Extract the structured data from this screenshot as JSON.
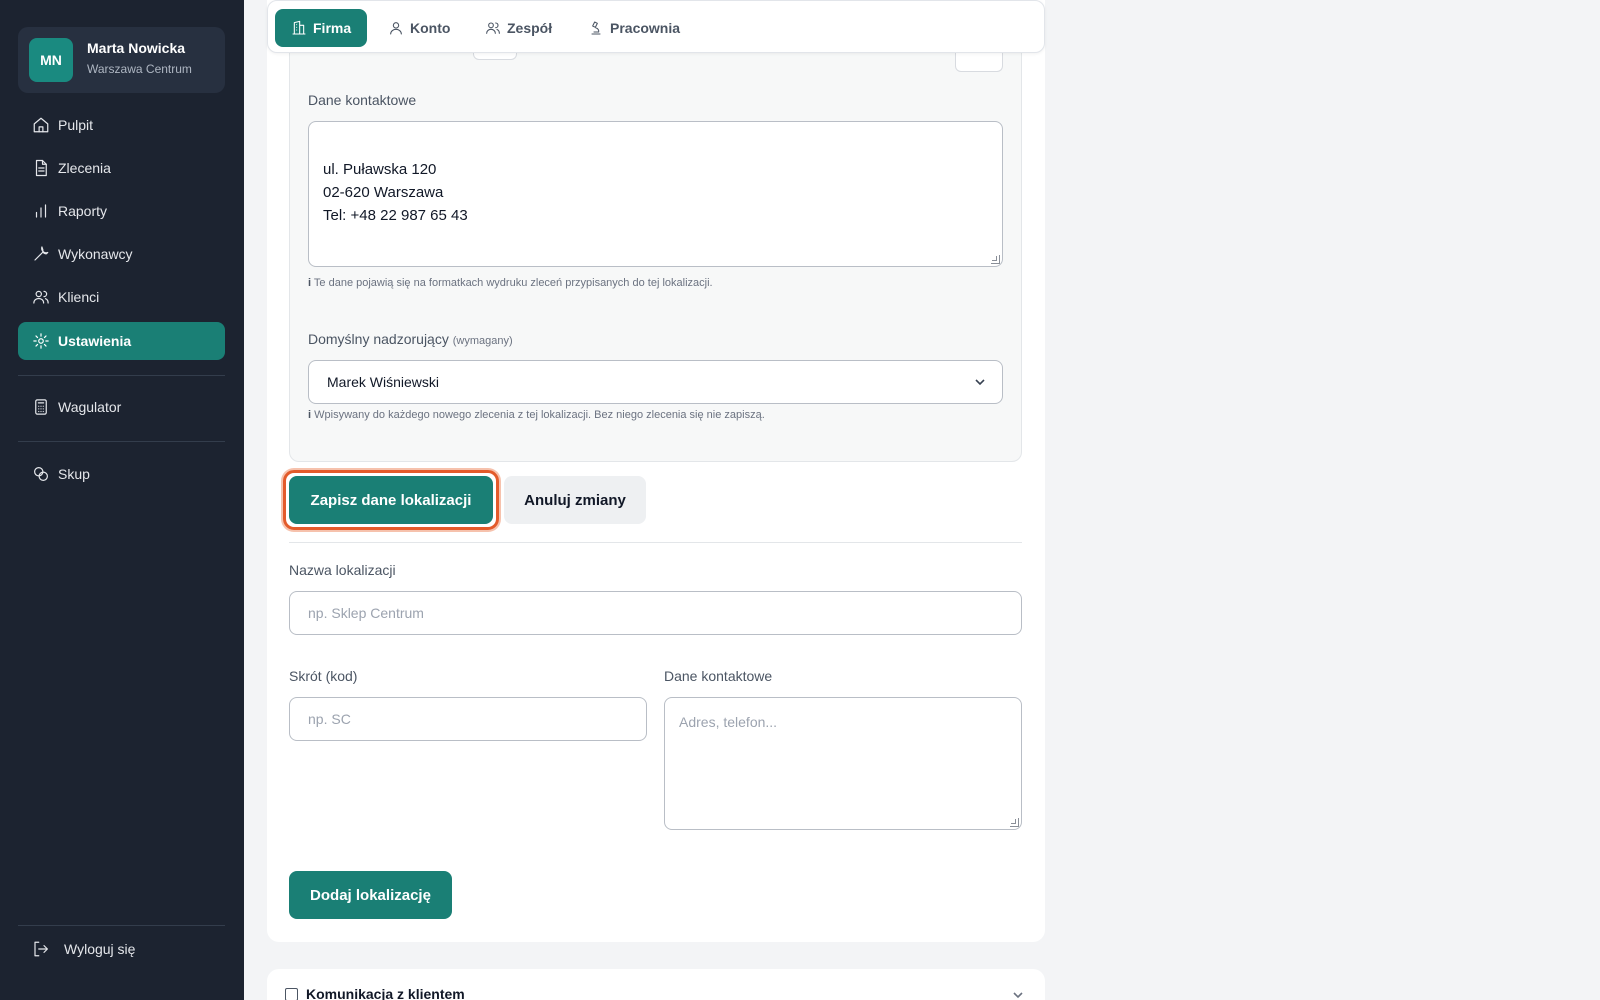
{
  "user": {
    "initials": "MN",
    "name": "Marta Nowicka",
    "location": "Warszawa Centrum"
  },
  "sidebar": {
    "items": [
      {
        "label": "Pulpit",
        "icon": "home-icon"
      },
      {
        "label": "Zlecenia",
        "icon": "document-icon"
      },
      {
        "label": "Raporty",
        "icon": "bar-chart-icon"
      },
      {
        "label": "Wykonawcy",
        "icon": "wrench-icon"
      },
      {
        "label": "Klienci",
        "icon": "users-icon"
      },
      {
        "label": "Ustawienia",
        "icon": "gear-icon",
        "active": true
      },
      {
        "label": "Wagulator",
        "icon": "calculator-icon"
      },
      {
        "label": "Skup",
        "icon": "coins-icon"
      }
    ],
    "logout": "Wyloguj się"
  },
  "tabs": [
    {
      "label": "Firma",
      "icon": "building-icon",
      "active": true
    },
    {
      "label": "Konto",
      "icon": "user-icon"
    },
    {
      "label": "Zespół",
      "icon": "team-icon"
    },
    {
      "label": "Pracownia",
      "icon": "microscope-icon"
    }
  ],
  "edit_location": {
    "contact_label": "Dane kontaktowe",
    "contact_value": "ul. Puławska 120\n02-620 Warszawa\nTel: +48 22 987 65 43",
    "contact_hint_icon": "i",
    "contact_hint": "Te dane pojawią się na formatkach wydruku zleceń przypisanych do tej lokalizacji.",
    "supervisor_label": "Domyślny nadzorujący",
    "supervisor_required": "(wymagany)",
    "supervisor_value": "Marek Wiśniewski",
    "supervisor_hint_icon": "i",
    "supervisor_hint": "Wpisywany do każdego nowego zlecenia z tej lokalizacji. Bez niego zlecenia się nie zapiszą.",
    "save_label": "Zapisz dane lokalizacji",
    "cancel_label": "Anuluj zmiany"
  },
  "new_location": {
    "name_label": "Nazwa lokalizacji",
    "name_placeholder": "np. Sklep Centrum",
    "code_label": "Skrót (kod)",
    "code_placeholder": "np. SC",
    "contact_label": "Dane kontaktowe",
    "contact_placeholder": "Adres, telefon...",
    "add_label": "Dodaj lokalizację"
  },
  "sections": [
    {
      "title": "Komunikacja z klientem"
    }
  ],
  "colors": {
    "sidebar_bg": "#1c2330",
    "accent": "#1a7f75",
    "focus": "#e35b2b"
  }
}
